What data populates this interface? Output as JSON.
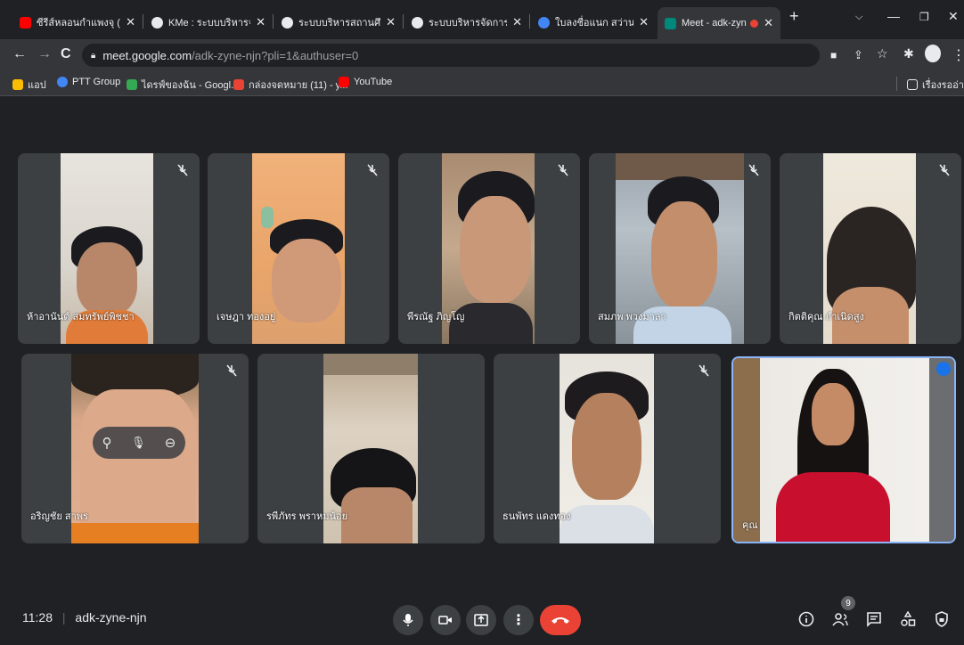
{
  "tabs": [
    {
      "title": "ซีรีส์หลอนกำแพงจุ (ต้องแ",
      "icon": "youtube-icon",
      "color": "#ff0000"
    },
    {
      "title": "KMe : ระบบบริหารจัดการ",
      "icon": "globe-icon",
      "color": "#e8eaed"
    },
    {
      "title": "ระบบบริหารสถานศึกษา",
      "icon": "globe-icon",
      "color": "#e8eaed"
    },
    {
      "title": "ระบบบริหารจัดการงานวัด",
      "icon": "globe-icon",
      "color": "#e8eaed"
    },
    {
      "title": "ใบลงชื่อแนก สว่าน - Goo",
      "icon": "google-icon",
      "color": "#4285f4"
    },
    {
      "title": "Meet - adk-zyne-",
      "icon": "meet-icon",
      "color": "#00897b"
    }
  ],
  "url": {
    "host": "meet.google.com",
    "path": "/adk-zyne-njn?pli=1&authuser=0"
  },
  "bookmarks": [
    {
      "label": "แอป",
      "icon": "apps-grid-icon",
      "color": "#fbbc04"
    },
    {
      "label": "PTT Group",
      "icon": "google-icon",
      "color": "#4285f4"
    },
    {
      "label": "ไดรฟ์ของฉัน - Googl...",
      "icon": "drive-icon",
      "color": "#34a853"
    },
    {
      "label": "กล่องจดหมาย (11) - y...",
      "icon": "gmail-icon",
      "color": "#ea4335"
    },
    {
      "label": "YouTube",
      "icon": "youtube-icon",
      "color": "#ff0000"
    }
  ],
  "reading_list": "เรื่องรออ่าน",
  "participants": [
    {
      "name": "ห้าอานันต์ สมทรัพย์พิชชา",
      "muted": true
    },
    {
      "name": "เจษฎา ทองอยู่",
      "muted": true
    },
    {
      "name": "พีรณัฐ ภิญโญ",
      "muted": true
    },
    {
      "name": "สมภพ พวงมาลา",
      "muted": true
    },
    {
      "name": "กิตติคุณ กำเนิดสูง",
      "muted": true
    },
    {
      "name": "อริญชัย สาพร",
      "muted": true
    },
    {
      "name": "รพีภัทร พราหมน้อย",
      "muted": true
    },
    {
      "name": "ธนพัทร แดงทอง",
      "muted": true
    },
    {
      "name": "คุณ",
      "muted": false
    }
  ],
  "meeting": {
    "time": "11:28",
    "separator": "|",
    "code": "adk-zyne-njn",
    "people_count": "9"
  }
}
